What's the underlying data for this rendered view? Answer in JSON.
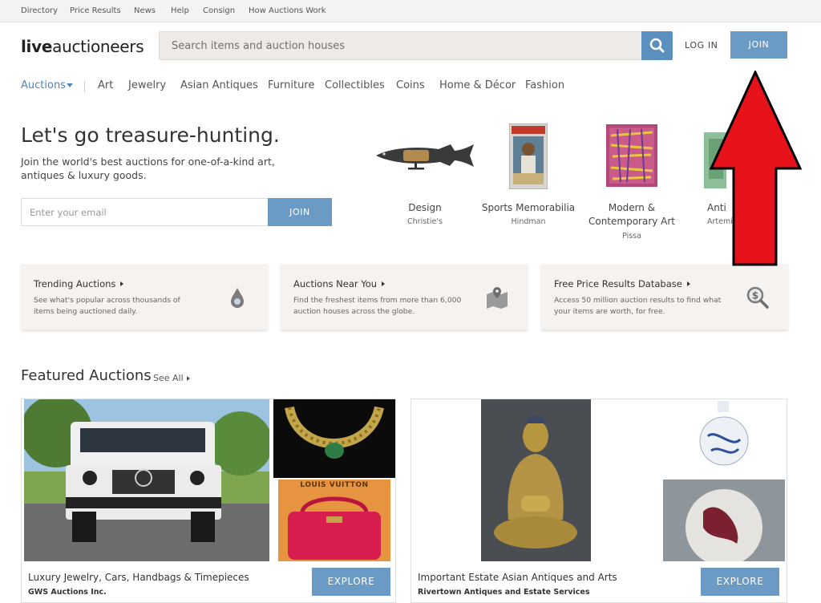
{
  "topbar": {
    "links": [
      "Directory",
      "Price Results",
      "News",
      "Help",
      "Consign",
      "How Auctions Work"
    ]
  },
  "header": {
    "logo_bold": "live",
    "logo_rest": "auctioneers",
    "search_placeholder": "Search items and auction houses",
    "login_label": "LOG IN",
    "join_label": "JOIN"
  },
  "categories": {
    "active": "Auctions",
    "items": [
      "Art",
      "Jewelry",
      "Asian Antiques",
      "Furniture",
      "Collectibles",
      "Coins",
      "Home & Décor",
      "Fashion"
    ]
  },
  "hero": {
    "title": "Let's go treasure-hunting.",
    "subtitle": "Join the world's best auctions for one-of-a-kind art, antiques & luxury goods.",
    "email_placeholder": "Enter your email",
    "join_label": "JOIN",
    "featured_categories": [
      {
        "title": "Design",
        "house": "Christie's"
      },
      {
        "title": "Sports Memorabilia",
        "house": "Hindman"
      },
      {
        "title": "Modern & Contemporary Art",
        "house": "Pissa"
      },
      {
        "title": "Anti",
        "house": "Artemi"
      }
    ]
  },
  "cards": [
    {
      "title": "Trending Auctions",
      "desc": "See what's popular across thousands of items being auctioned daily."
    },
    {
      "title": "Auctions Near You",
      "desc": "Find the freshest items from more than 6,000 auction houses across the globe."
    },
    {
      "title": "Free Price Results Database",
      "desc": "Access 50 million auction results to find what your items are worth, for free."
    }
  ],
  "featured": {
    "title": "Featured Auctions",
    "see_all": "See All",
    "auctions": [
      {
        "name": "Luxury Jewelry, Cars, Handbags & Timepieces",
        "house": "GWS Auctions Inc.",
        "cta": "EXPLORE"
      },
      {
        "name": "Important Estate Asian Antiques and Arts",
        "house": "Rivertown Antiques and Estate Services",
        "cta": "EXPLORE"
      }
    ],
    "photo_text": {
      "handbag_brand": "LOUIS VUITTON"
    }
  },
  "colors": {
    "accent": "#6b9bc4",
    "annotation": "#e8131a",
    "card_bg": "#f5f2f0",
    "topbar_bg": "#f5f3f2"
  }
}
